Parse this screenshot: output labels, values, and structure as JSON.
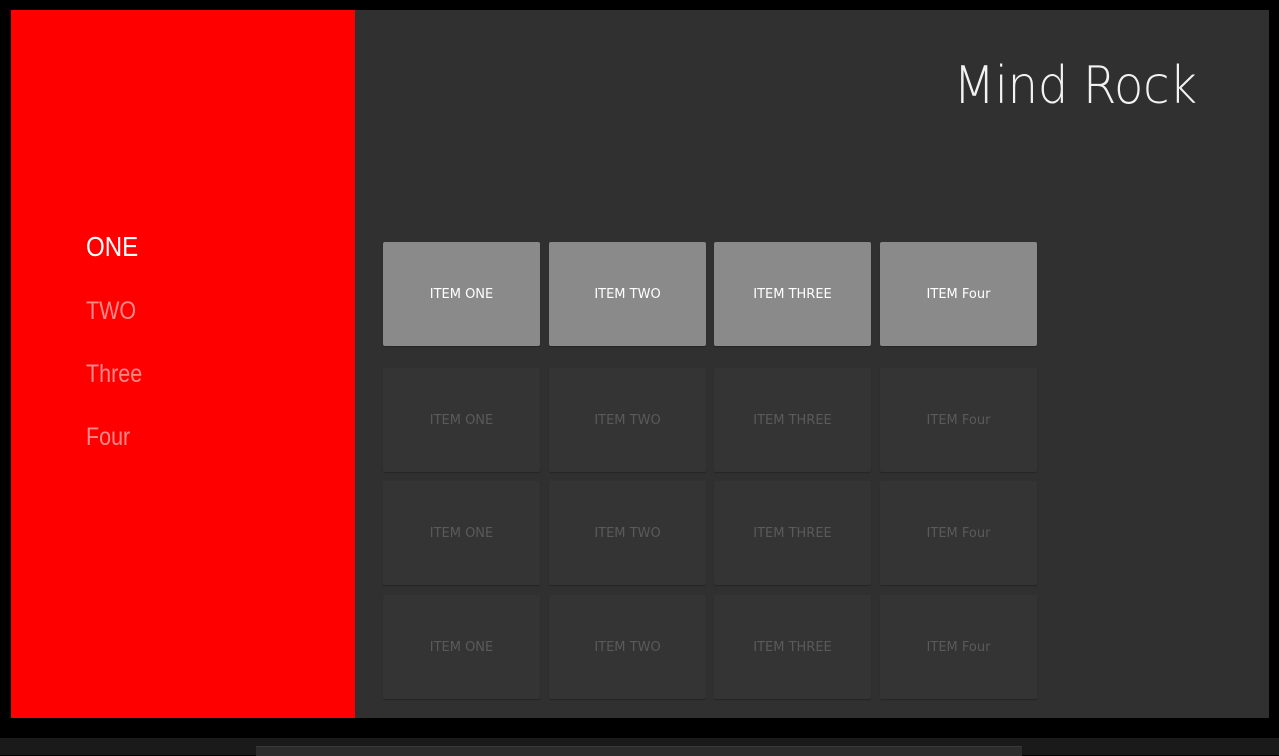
{
  "app": {
    "title": "Mind Rock",
    "accent_color": "#ff0000",
    "background_color": "#303030"
  },
  "sidebar": {
    "items": [
      {
        "label": "ONE",
        "active": true
      },
      {
        "label": "TWO",
        "active": false
      },
      {
        "label": "Three",
        "active": false
      },
      {
        "label": "Four",
        "active": false
      }
    ]
  },
  "rows": [
    {
      "focused": true,
      "items": [
        "ITEM ONE",
        "ITEM TWO",
        "ITEM THREE",
        "ITEM Four"
      ]
    },
    {
      "focused": false,
      "items": [
        "ITEM ONE",
        "ITEM TWO",
        "ITEM THREE",
        "ITEM Four"
      ]
    },
    {
      "focused": false,
      "items": [
        "ITEM ONE",
        "ITEM TWO",
        "ITEM THREE",
        "ITEM Four"
      ]
    },
    {
      "focused": false,
      "items": [
        "ITEM ONE",
        "ITEM TWO",
        "ITEM THREE",
        "ITEM Four"
      ]
    }
  ]
}
